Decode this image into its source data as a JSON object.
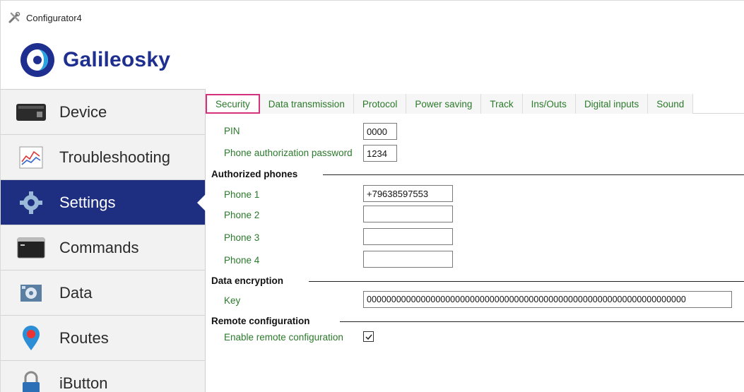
{
  "window": {
    "title": "Configurator4"
  },
  "brand": {
    "name": "Galileosky"
  },
  "sidebar": {
    "items": [
      {
        "label": "Device",
        "icon": "device-icon"
      },
      {
        "label": "Troubleshooting",
        "icon": "troubleshooting-icon"
      },
      {
        "label": "Settings",
        "icon": "gear-icon",
        "active": true
      },
      {
        "label": "Commands",
        "icon": "terminal-icon"
      },
      {
        "label": "Data",
        "icon": "data-icon"
      },
      {
        "label": "Routes",
        "icon": "map-pin-icon"
      },
      {
        "label": "iButton",
        "icon": "lock-icon"
      }
    ],
    "active_color": "#1e2f82"
  },
  "tabs": [
    {
      "label": "Security",
      "active": true
    },
    {
      "label": "Data transmission"
    },
    {
      "label": "Protocol"
    },
    {
      "label": "Power saving"
    },
    {
      "label": "Track"
    },
    {
      "label": "Ins/Outs"
    },
    {
      "label": "Digital inputs"
    },
    {
      "label": "Sound"
    }
  ],
  "security": {
    "pin_label": "PIN",
    "pin_value": "0000",
    "phone_auth_label": "Phone authorization password",
    "phone_auth_value": "1234",
    "authorized_phones_title": "Authorized phones",
    "phones": [
      {
        "label": "Phone 1",
        "value": "+79638597553"
      },
      {
        "label": "Phone 2",
        "value": ""
      },
      {
        "label": "Phone 3",
        "value": ""
      },
      {
        "label": "Phone 4",
        "value": ""
      }
    ],
    "encryption_title": "Data encryption",
    "key_label": "Key",
    "key_value": "00000000000000000000000000000000000000000000000000000000000000000",
    "remote_title": "Remote configuration",
    "remote_enable_label": "Enable remote configuration",
    "remote_enabled": true
  },
  "colors": {
    "label_green": "#2b7a2b",
    "highlight": "#d6317c"
  }
}
